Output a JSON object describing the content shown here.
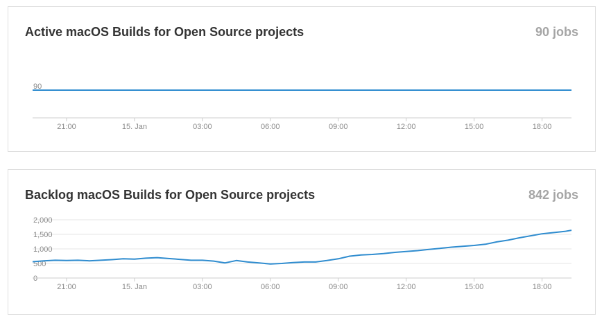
{
  "panels": [
    {
      "title": "Active macOS Builds for Open Source projects",
      "count": "90 jobs"
    },
    {
      "title": "Backlog macOS Builds for Open Source projects",
      "count": "842 jobs"
    }
  ],
  "colors": {
    "line": "#2f8ccf",
    "grid": "#e6e6e6",
    "axis": "#cccccc"
  },
  "chart_data": [
    {
      "type": "line",
      "title": "Active macOS Builds for Open Source projects",
      "x_tick_labels": [
        "21:00",
        "15. Jan",
        "03:00",
        "06:00",
        "09:00",
        "12:00",
        "15:00",
        "18:00"
      ],
      "x_range_hours": [
        -4.5,
        19.3
      ],
      "y_tick_labels": [
        "90"
      ],
      "y_ticks": [
        90
      ],
      "ylim": [
        88,
        92
      ],
      "grid": true,
      "series": [
        {
          "x": [
            -4.5,
            19.3
          ],
          "y": [
            90,
            90
          ]
        }
      ]
    },
    {
      "type": "line",
      "title": "Backlog macOS Builds for Open Source projects",
      "x_tick_labels": [
        "21:00",
        "15. Jan",
        "03:00",
        "06:00",
        "09:00",
        "12:00",
        "15:00",
        "18:00"
      ],
      "x_range_hours": [
        -4.5,
        19.3
      ],
      "y_tick_labels": [
        "2,000",
        "1,500",
        "1,000",
        "500",
        "0"
      ],
      "y_ticks": [
        2000,
        1500,
        1000,
        500,
        0
      ],
      "ylim": [
        0,
        2000
      ],
      "grid": true,
      "series": [
        {
          "x": [
            -4.5,
            -4.0,
            -3.5,
            -3.0,
            -2.5,
            -2.0,
            -1.5,
            -1.0,
            -0.5,
            0,
            0.5,
            1.0,
            1.5,
            2.0,
            2.5,
            3.0,
            3.5,
            4.0,
            4.5,
            5.0,
            5.5,
            6.0,
            6.5,
            7.0,
            7.5,
            8.0,
            8.5,
            9.0,
            9.5,
            10.0,
            10.5,
            11.0,
            11.5,
            12.0,
            12.5,
            13.0,
            13.5,
            14.0,
            14.5,
            15.0,
            15.5,
            16.0,
            16.5,
            17.0,
            17.5,
            18.0,
            18.5,
            19.0,
            19.3
          ],
          "y": [
            560,
            590,
            610,
            600,
            610,
            590,
            610,
            630,
            660,
            650,
            680,
            700,
            670,
            640,
            610,
            610,
            580,
            520,
            600,
            550,
            520,
            480,
            500,
            530,
            550,
            550,
            600,
            660,
            750,
            790,
            810,
            840,
            880,
            910,
            940,
            980,
            1020,
            1060,
            1090,
            1120,
            1160,
            1240,
            1300,
            1380,
            1450,
            1520,
            1560,
            1600,
            1640
          ]
        }
      ]
    }
  ]
}
